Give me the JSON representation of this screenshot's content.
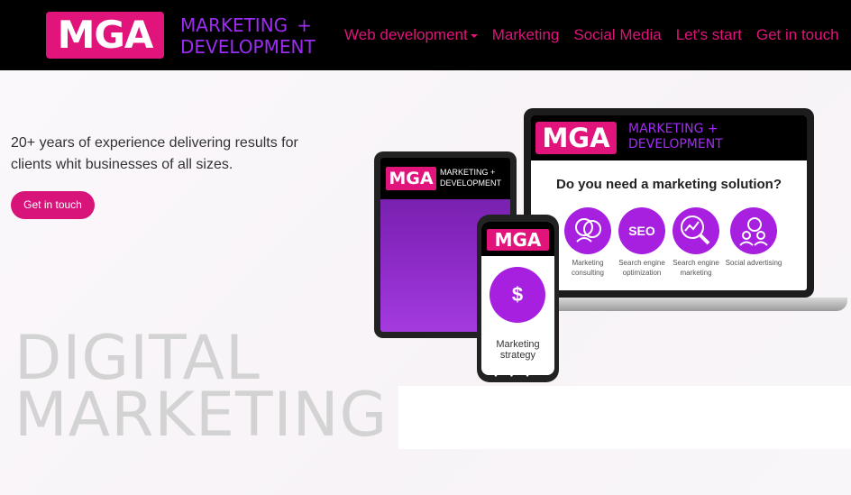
{
  "brand": {
    "logo": "MGA",
    "tagline_line1": "MARKETING",
    "tagline_plus": "+",
    "tagline_line2": "DEVELOPMENT"
  },
  "nav": {
    "items": [
      "Web development",
      "Marketing",
      "Social Media",
      "Let's start",
      "Get in touch"
    ]
  },
  "hero": {
    "tagline": "20+ years of experience delivering results for clients whit businesses of all sizes.",
    "cta": "Get in touch",
    "big_line1": "DIGITAL",
    "big_line2": "MARKETING"
  },
  "mockup": {
    "laptop_logo": "MGA",
    "laptop_tag1": "MARKETING  +",
    "laptop_tag2": "DEVELOPMENT",
    "question": "Do you need a marketing solution?",
    "services": [
      {
        "icon": "people-head-icon",
        "label": "Marketing consulting"
      },
      {
        "icon": "seo-magnifier-icon",
        "label": "Search engine optimization",
        "glyph": "SEO"
      },
      {
        "icon": "graph-magnifier-icon",
        "label": "Search engine marketing"
      },
      {
        "icon": "social-chat-icon",
        "label": "Social advertising"
      }
    ],
    "tablet_logo": "MGA",
    "tablet_tag1": "MARKETING +",
    "tablet_tag2": "DEVELOPMENT",
    "phone_logo": "MGA",
    "phone_icon_glyph": "$",
    "phone_label": "Marketing strategy"
  },
  "colors": {
    "brand_pink": "#e0147a",
    "brand_purple": "#9b2cf0",
    "nav_bg": "#000000"
  }
}
